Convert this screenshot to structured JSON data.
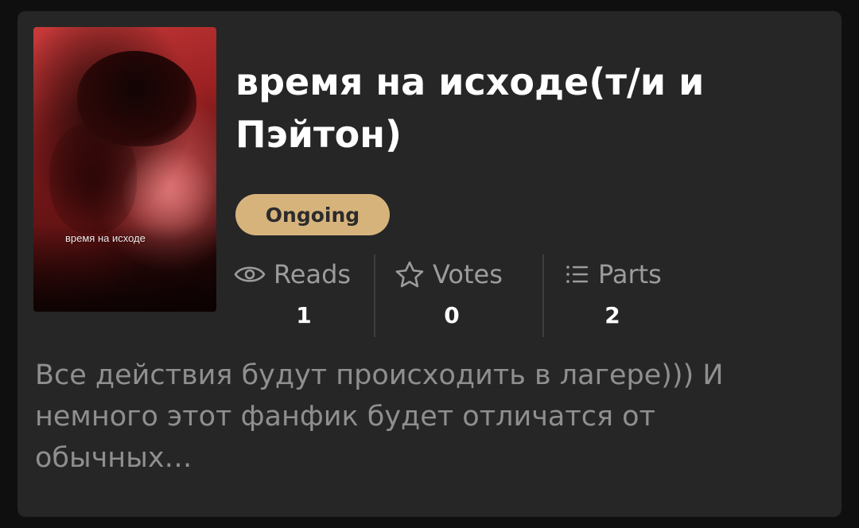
{
  "story": {
    "title": "время на исходе(т/и и Пэйтон)",
    "cover_text": "время на исходе",
    "status": "Ongoing",
    "description": "Все действия будут происходить в лагере))) И немного этот фанфик будет отличатся от обычных…"
  },
  "stats": {
    "reads": {
      "label": "Reads",
      "value": "1",
      "icon": "eye-icon"
    },
    "votes": {
      "label": "Votes",
      "value": "0",
      "icon": "star-icon"
    },
    "parts": {
      "label": "Parts",
      "value": "2",
      "icon": "list-icon"
    }
  },
  "colors": {
    "card_background": "#262626",
    "page_background": "#0f0f0f",
    "badge_background": "#d7b37c",
    "muted_text": "#9c9c9c"
  }
}
